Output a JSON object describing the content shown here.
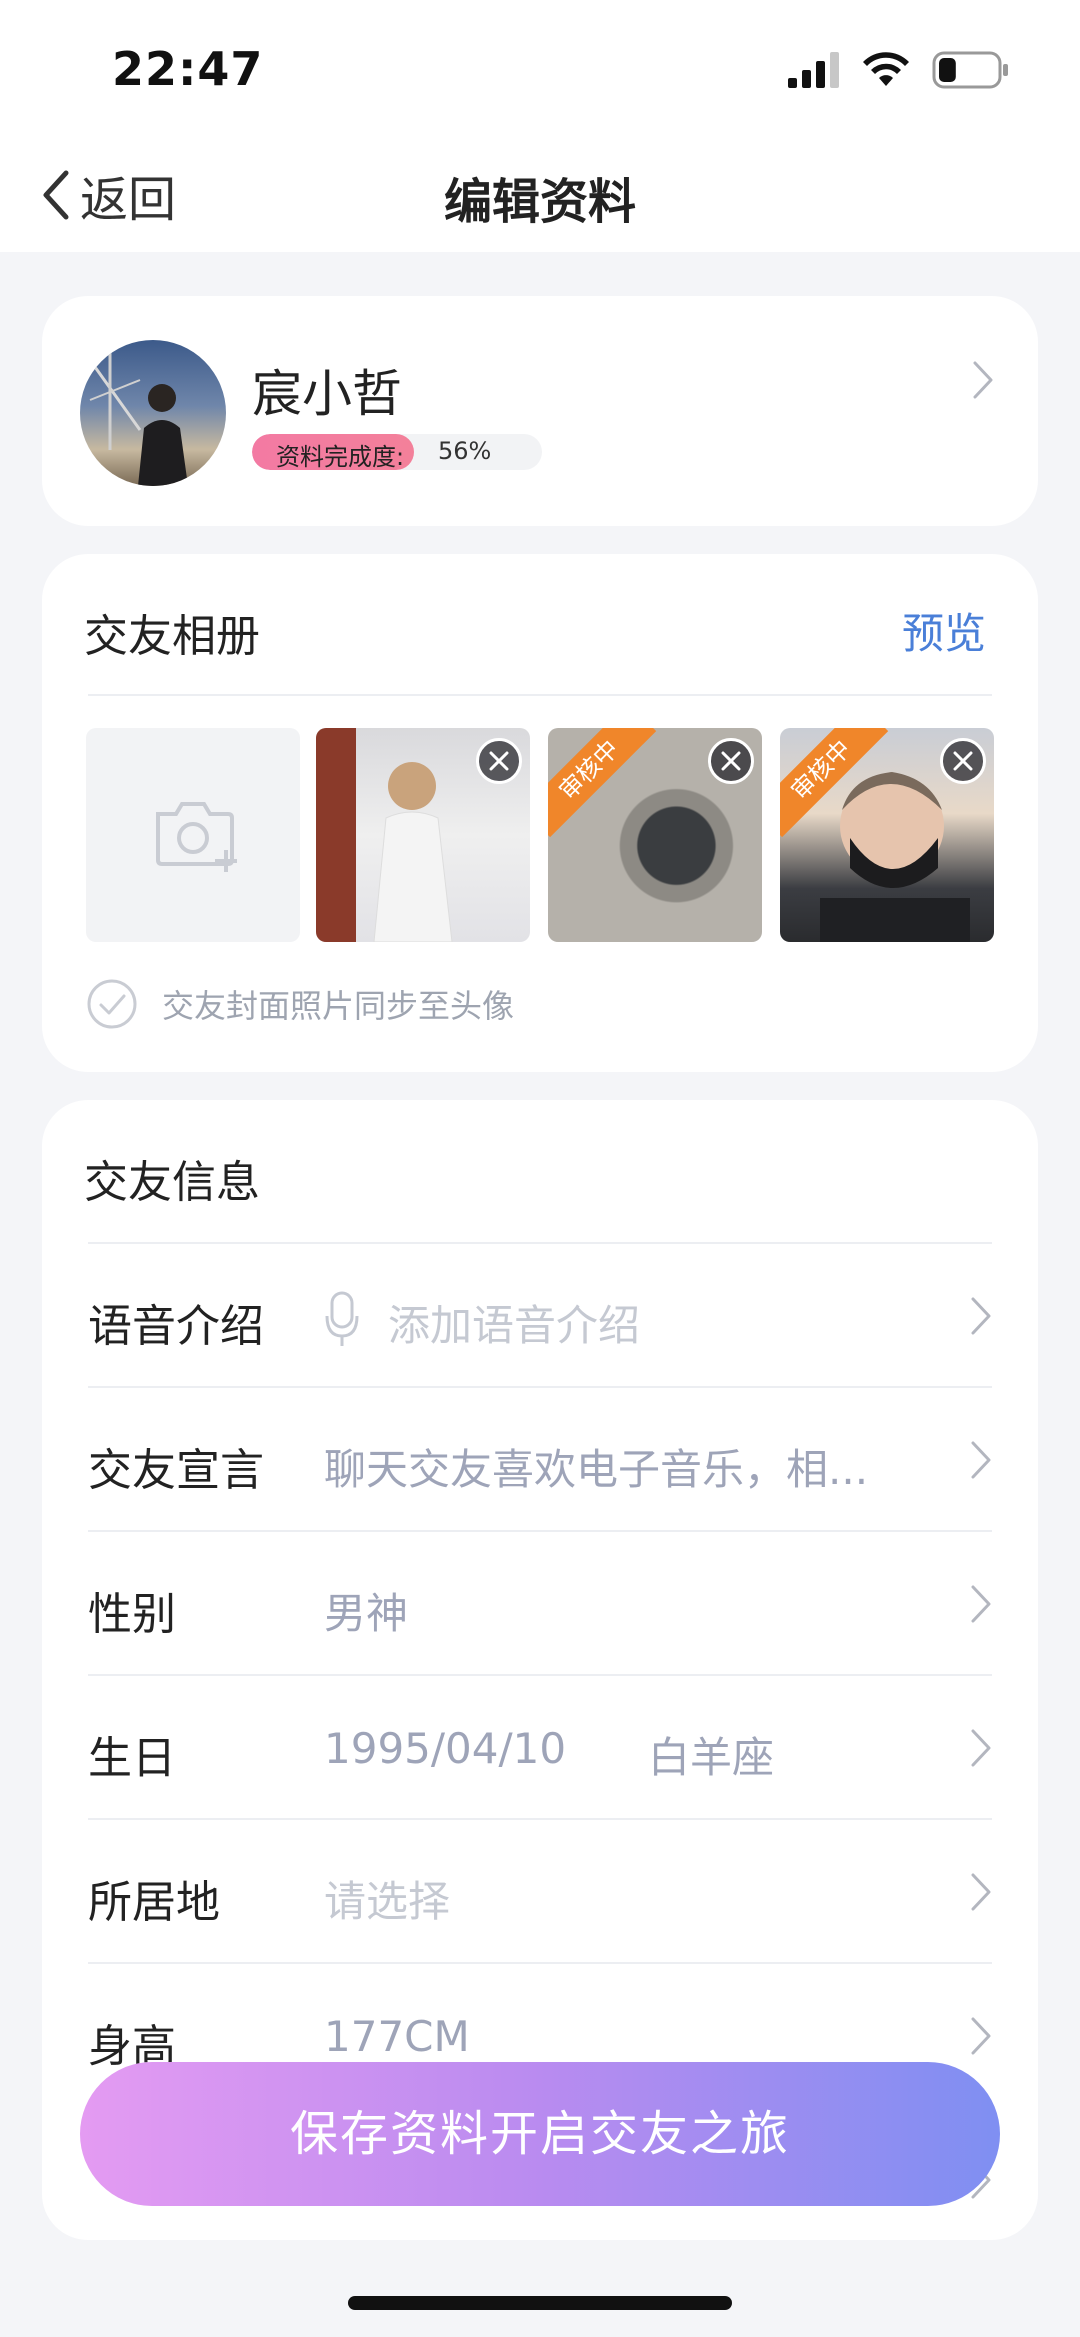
{
  "status_bar": {
    "time": "22:47",
    "battery_level": 0.3
  },
  "nav": {
    "back_label": "返回",
    "title": "编辑资料"
  },
  "profile": {
    "name": "宸小哲",
    "completion_label": "资料完成度:",
    "completion_value": "56%",
    "completion_fraction": 0.56
  },
  "album": {
    "title": "交友相册",
    "preview_label": "预览",
    "photos": [
      {
        "status": ""
      },
      {
        "status": "审核中"
      },
      {
        "status": "审核中"
      }
    ],
    "sync_text": "交友封面照片同步至头像"
  },
  "info": {
    "title": "交友信息",
    "rows": [
      {
        "label": "语音介绍",
        "value": "添加语音介绍",
        "placeholder": true
      },
      {
        "label": "交友宣言",
        "value": "聊天交友喜欢电子音乐，相...",
        "placeholder": false
      },
      {
        "label": "性别",
        "value": "男神",
        "placeholder": false
      },
      {
        "label": "生日",
        "value": "1995/04/10",
        "extra": "白羊座",
        "placeholder": false
      },
      {
        "label": "所居地",
        "value": "请选择",
        "placeholder": true
      },
      {
        "label": "身高",
        "value": "177CM",
        "placeholder": false
      }
    ]
  },
  "cta_label": "保存资料开启交友之旅",
  "colors": {
    "accent": "#4a7fd8",
    "badge": "#f0862a",
    "progress": "#f37aa3"
  }
}
